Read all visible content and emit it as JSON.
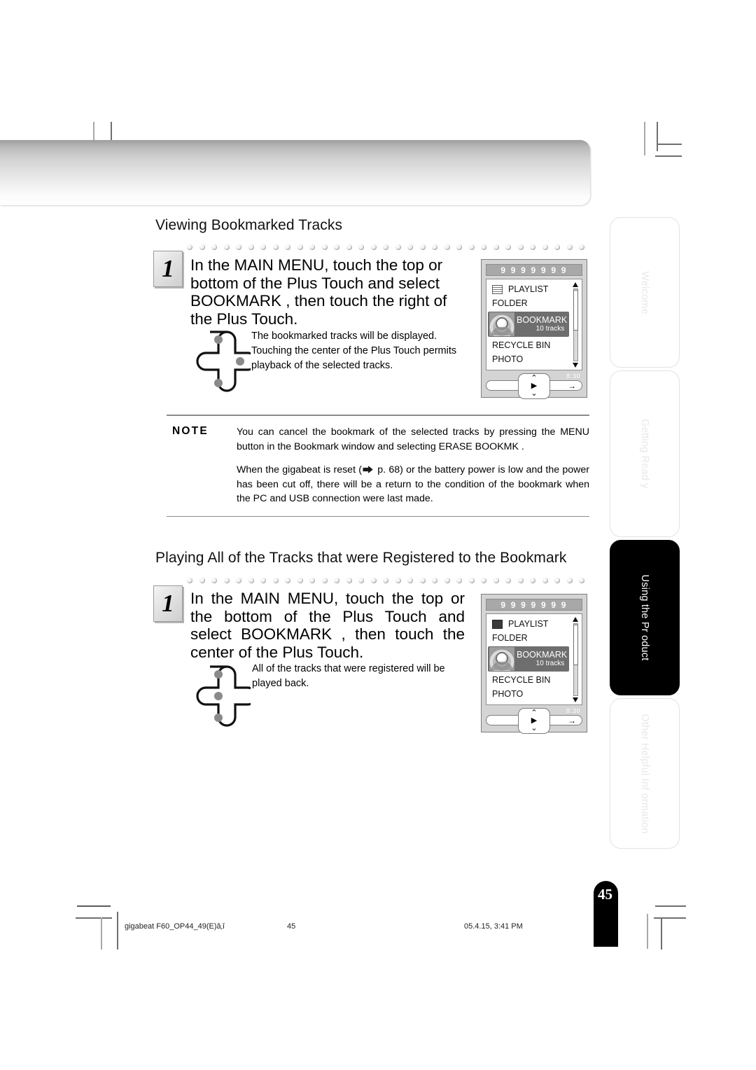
{
  "page": {
    "number": "45",
    "badge_number": "45"
  },
  "sections": [
    {
      "title": "Viewing Bookmarked Tracks",
      "step_number": "1",
      "step_text": "In the MAIN MENU, touch the top or bottom of the Plus Touch and select  BOOKMARK  , then touch the right of the Plus Touch.",
      "sub_text_lines": [
        "The bookmarked tracks will be displayed.",
        "Touching the center of the Plus Touch permits playback of the selected tracks."
      ]
    },
    {
      "title": "Playing All of the Tracks that were Registered to the Bookmark",
      "step_number": "1",
      "step_text": "In the MAIN MENU, touch the top or the bottom of the Plus Touch and select  BOOKMARK  , then touch the center of the Plus Touch.",
      "sub_text_lines": [
        "All of the tracks that were registered will be played back."
      ]
    }
  ],
  "device": {
    "title_bar": "9 9 9 9 9 9 9",
    "items": [
      {
        "label": "PLAYLIST",
        "icon": "playlist-icon",
        "selected": false
      },
      {
        "label": "FOLDER",
        "icon": "",
        "selected": false
      },
      {
        "label": "BOOKMARK",
        "sub": "10 tracks",
        "icon": "bookmark-icon",
        "selected": true
      },
      {
        "label": "RECYCLE BIN",
        "icon": "",
        "selected": false
      },
      {
        "label": "PHOTO",
        "icon": "",
        "selected": false
      }
    ],
    "time": "8:30",
    "pad_up": "⌃",
    "pad_play": "▶",
    "pad_down": "⌄",
    "right_arrow": "→"
  },
  "note": {
    "label": "NOTE",
    "paragraph_1": "You can cancel the bookmark of the selected tracks by pressing the MENU button in the Bookmark window and selecting ERASE BOOKMK .",
    "paragraph_2_before": "When the gigabeat is reset (",
    "paragraph_2_after": " p. 68) or the battery power is low and the power has been cut off, there will be a return to the condition of the bookmark when the PC and USB connection were last made."
  },
  "tabs": [
    {
      "label": "Welcome",
      "active": false
    },
    {
      "label": "Getting Read y",
      "active": false
    },
    {
      "label": "Using the Pr oduct",
      "active": true
    },
    {
      "label": "Other Helpful Inf ormation",
      "active": false
    }
  ],
  "footer": {
    "file": "gigabeat F60_OP44_49(E)â‚î",
    "page": "45",
    "date": "05.4.15, 3:41 PM"
  }
}
